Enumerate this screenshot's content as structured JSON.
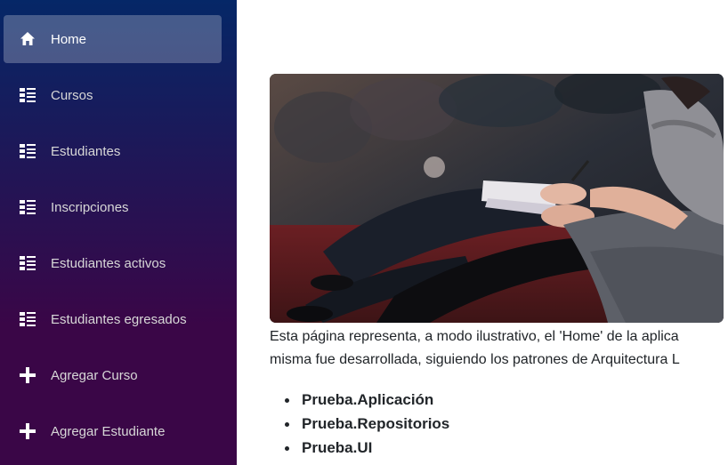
{
  "sidebar": {
    "items": [
      {
        "label": "Home",
        "icon": "home-icon",
        "active": true
      },
      {
        "label": "Cursos",
        "icon": "list-icon"
      },
      {
        "label": "Estudiantes",
        "icon": "list-icon"
      },
      {
        "label": "Inscripciones",
        "icon": "list-icon"
      },
      {
        "label": "Estudiantes activos",
        "icon": "list-icon"
      },
      {
        "label": "Estudiantes egresados",
        "icon": "list-icon"
      },
      {
        "label": "Agregar Curso",
        "icon": "plus-icon"
      },
      {
        "label": "Agregar Estudiante",
        "icon": "plus-icon"
      }
    ],
    "colors": {
      "gradient_top": "#052767",
      "gradient_bottom": "#3a0647",
      "active_bg": "rgba(255,255,255,0.25)"
    }
  },
  "main": {
    "hero_image": "audience-taking-notes-photo",
    "paragraph": {
      "line1": "Esta página representa, a modo ilustrativo, el 'Home' de la aplica",
      "line2": "misma fue desarrollada, siguiendo los patrones de Arquitectura L"
    },
    "bullets": [
      "Prueba.Aplicación",
      "Prueba.Repositorios",
      "Prueba.UI"
    ]
  }
}
